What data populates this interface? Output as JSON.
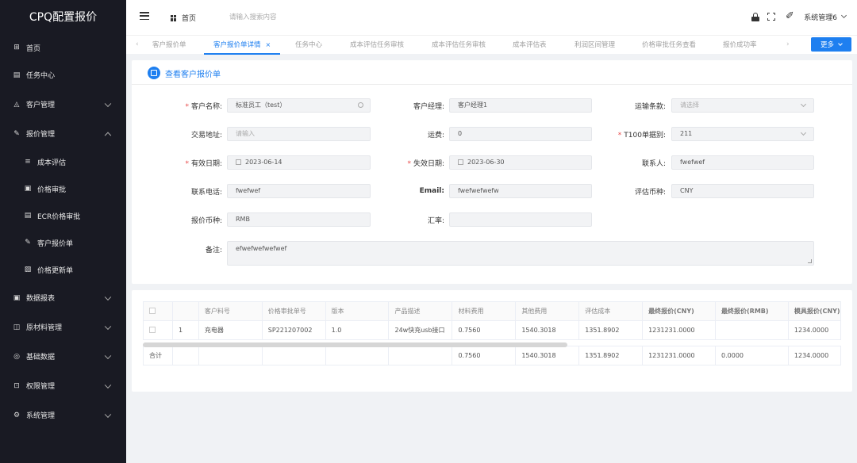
{
  "app": {
    "title": "CPQ配置报价"
  },
  "sidebar": {
    "items": [
      {
        "label": "首页",
        "icon": "grid-icon",
        "glyph": "⊞"
      },
      {
        "label": "任务中心",
        "icon": "task-icon",
        "glyph": "▤"
      },
      {
        "label": "客户管理",
        "icon": "customer-icon",
        "glyph": "◬"
      },
      {
        "label": "报价管理",
        "icon": "quote-icon",
        "glyph": "✎"
      },
      {
        "label": "成本评估",
        "icon": "list-icon",
        "glyph": "≡"
      },
      {
        "label": "价格审批",
        "icon": "doc-icon",
        "glyph": "▣"
      },
      {
        "label": "ECR价格审批",
        "icon": "doc-check-icon",
        "glyph": "▤"
      },
      {
        "label": "客户报价单",
        "icon": "pen-icon",
        "glyph": "✎"
      },
      {
        "label": "价格更新单",
        "icon": "edit-doc-icon",
        "glyph": "▨"
      },
      {
        "label": "数据报表",
        "icon": "report-icon",
        "glyph": "▣"
      },
      {
        "label": "原材料管理",
        "icon": "material-icon",
        "glyph": "◫"
      },
      {
        "label": "基础数据",
        "icon": "data-icon",
        "glyph": "◎"
      },
      {
        "label": "权限管理",
        "icon": "lock-icon",
        "glyph": "⊡"
      },
      {
        "label": "系统管理",
        "icon": "settings-icon",
        "glyph": "⚙"
      }
    ]
  },
  "header": {
    "home": "首页",
    "search_placeholder": "请输入搜索内容",
    "user": "系统管理6",
    "user_glyph": "✐"
  },
  "tabs": [
    {
      "label": "客户报价单"
    },
    {
      "label": "客户报价单详情",
      "close": "×"
    },
    {
      "label": "任务中心"
    },
    {
      "label": "成本评估任务审核"
    },
    {
      "label": "成本评估任务审核"
    },
    {
      "label": "成本评估表"
    },
    {
      "label": "利润区间管理"
    },
    {
      "label": "价格审批任务查看"
    },
    {
      "label": "报价成功率"
    }
  ],
  "tab_nav": {
    "prev": "‹",
    "next": "›"
  },
  "more_button": "更多",
  "card": {
    "title": "查看客户报价单"
  },
  "form": {
    "customer_name": {
      "label": "客户名称:",
      "required": "*",
      "value": "标准员工（test）"
    },
    "customer_manager": {
      "label": "客户经理:",
      "value": "客户经理1"
    },
    "shipping_terms": {
      "label": "运输条款:",
      "placeholder": "请选择"
    },
    "trade_address": {
      "label": "交易地址:",
      "placeholder": "请输入"
    },
    "freight": {
      "label": "运费:",
      "value": "0"
    },
    "t100_type": {
      "label": "T100单据别:",
      "required": "*",
      "value": "211"
    },
    "effective_date": {
      "label": "有效日期:",
      "required": "*",
      "value": "2023-06-14"
    },
    "expiry_date": {
      "label": "失效日期:",
      "required": "*",
      "value": "2023-06-30"
    },
    "contact": {
      "label": "联系人:",
      "value": "fwefwef"
    },
    "phone": {
      "label": "联系电话:",
      "value": "fwefwef"
    },
    "email": {
      "label": "Email:",
      "value": "fwefwefwefw"
    },
    "eval_currency": {
      "label": "评估币种:",
      "value": "CNY"
    },
    "quote_currency": {
      "label": "报价币种:",
      "value": "RMB"
    },
    "exchange_rate": {
      "label": "汇率:",
      "value": ""
    },
    "remark": {
      "label": "备注:",
      "value": "efwefwefwefwef"
    }
  },
  "table": {
    "headers": [
      "",
      "",
      "客户料号",
      "价格审批单号",
      "版本",
      "产品描述",
      "材料费用",
      "其他费用",
      "评估成本",
      "最终报价(CNY)",
      "最终报价(RMB)",
      "模具报价(CNY)"
    ],
    "rows": [
      [
        "",
        "1",
        "充电器",
        "SP221207002",
        "1.0",
        "24w快充usb接口",
        "0.7560",
        "1540.3018",
        "1351.8902",
        "1231231.0000",
        "",
        "1234.0000"
      ]
    ],
    "total": [
      "合计",
      "",
      "",
      "",
      "",
      "",
      "0.7560",
      "1540.3018",
      "1351.8902",
      "1231231.0000",
      "0.0000",
      "1234.0000"
    ]
  },
  "colors": {
    "accent": "#1e7ff0",
    "sidebar_bg": "#191a23",
    "required": "#e84a4a"
  }
}
